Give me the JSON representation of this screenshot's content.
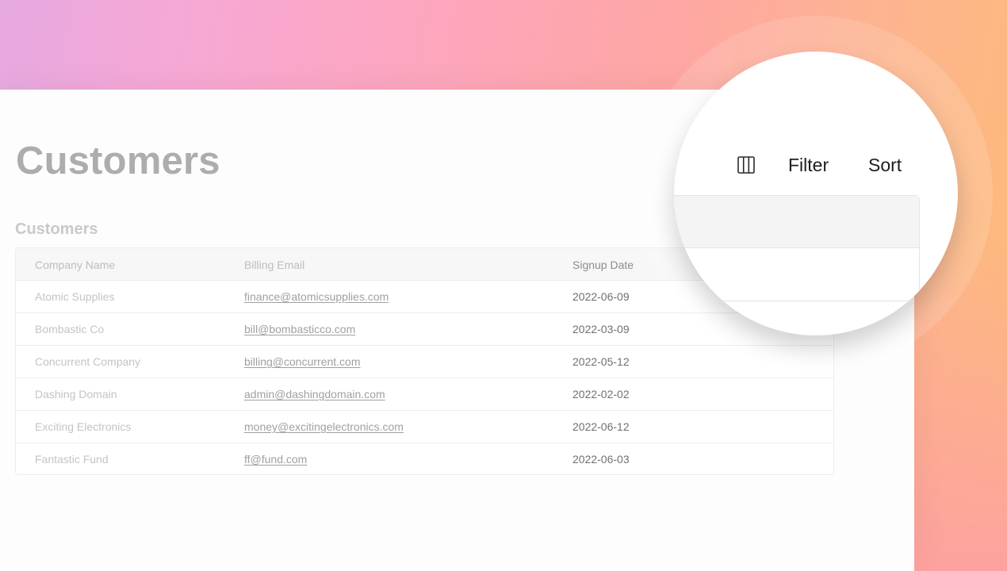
{
  "page": {
    "title": "Customers"
  },
  "section": {
    "title": "Customers"
  },
  "table": {
    "columns": [
      "Company Name",
      "Billing Email",
      "Signup Date"
    ],
    "rows": [
      {
        "company": "Atomic Supplies",
        "email": "finance@atomicsupplies.com",
        "date": "2022-06-09"
      },
      {
        "company": "Bombastic Co",
        "email": "bill@bombasticco.com",
        "date": "2022-03-09"
      },
      {
        "company": "Concurrent Company",
        "email": "billing@concurrent.com",
        "date": "2022-05-12"
      },
      {
        "company": "Dashing Domain",
        "email": "admin@dashingdomain.com",
        "date": "2022-02-02"
      },
      {
        "company": "Exciting Electronics",
        "email": "money@excitingelectronics.com",
        "date": "2022-06-12"
      },
      {
        "company": "Fantastic Fund",
        "email": "ff@fund.com",
        "date": "2022-06-03"
      }
    ]
  },
  "toolbar": {
    "columns_icon": "columns-icon",
    "filter_label": "Filter",
    "sort_label": "Sort"
  },
  "colors": {
    "gradient_left": "#e6a9e0",
    "gradient_mid": "#fda6bd",
    "gradient_right": "#fdbb78",
    "title_gray": "#adadad"
  }
}
